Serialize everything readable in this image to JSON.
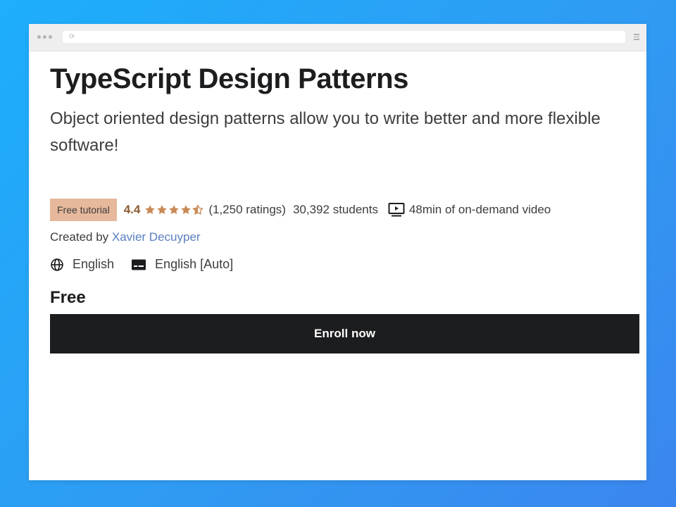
{
  "course": {
    "title": "TypeScript Design Patterns",
    "subtitle": "Object oriented design patterns allow you to write better and more flexible software!",
    "badge": "Free tutorial",
    "rating": "4.4",
    "rating_count": "(1,250 ratings)",
    "students": "30,392 students",
    "video_length": "48min of on-demand video",
    "created_by_label": "Created by",
    "instructor": "Xavier Decuyper",
    "language": "English",
    "captions": "English [Auto]",
    "price": "Free",
    "enroll_label": "Enroll now"
  },
  "icons": {
    "star": "star-icon",
    "video": "video-icon",
    "globe": "globe-icon",
    "captions": "closed-captions-icon"
  },
  "colors": {
    "background_gradient_start": "#1daefc",
    "background_gradient_end": "#3b86ee",
    "badge_bg": "#e6b89c",
    "star": "#c98a57",
    "rating_text": "#8a5a2f",
    "link": "#5a7fc0",
    "button_bg": "#1c1d1f",
    "button_text": "#ffffff"
  }
}
